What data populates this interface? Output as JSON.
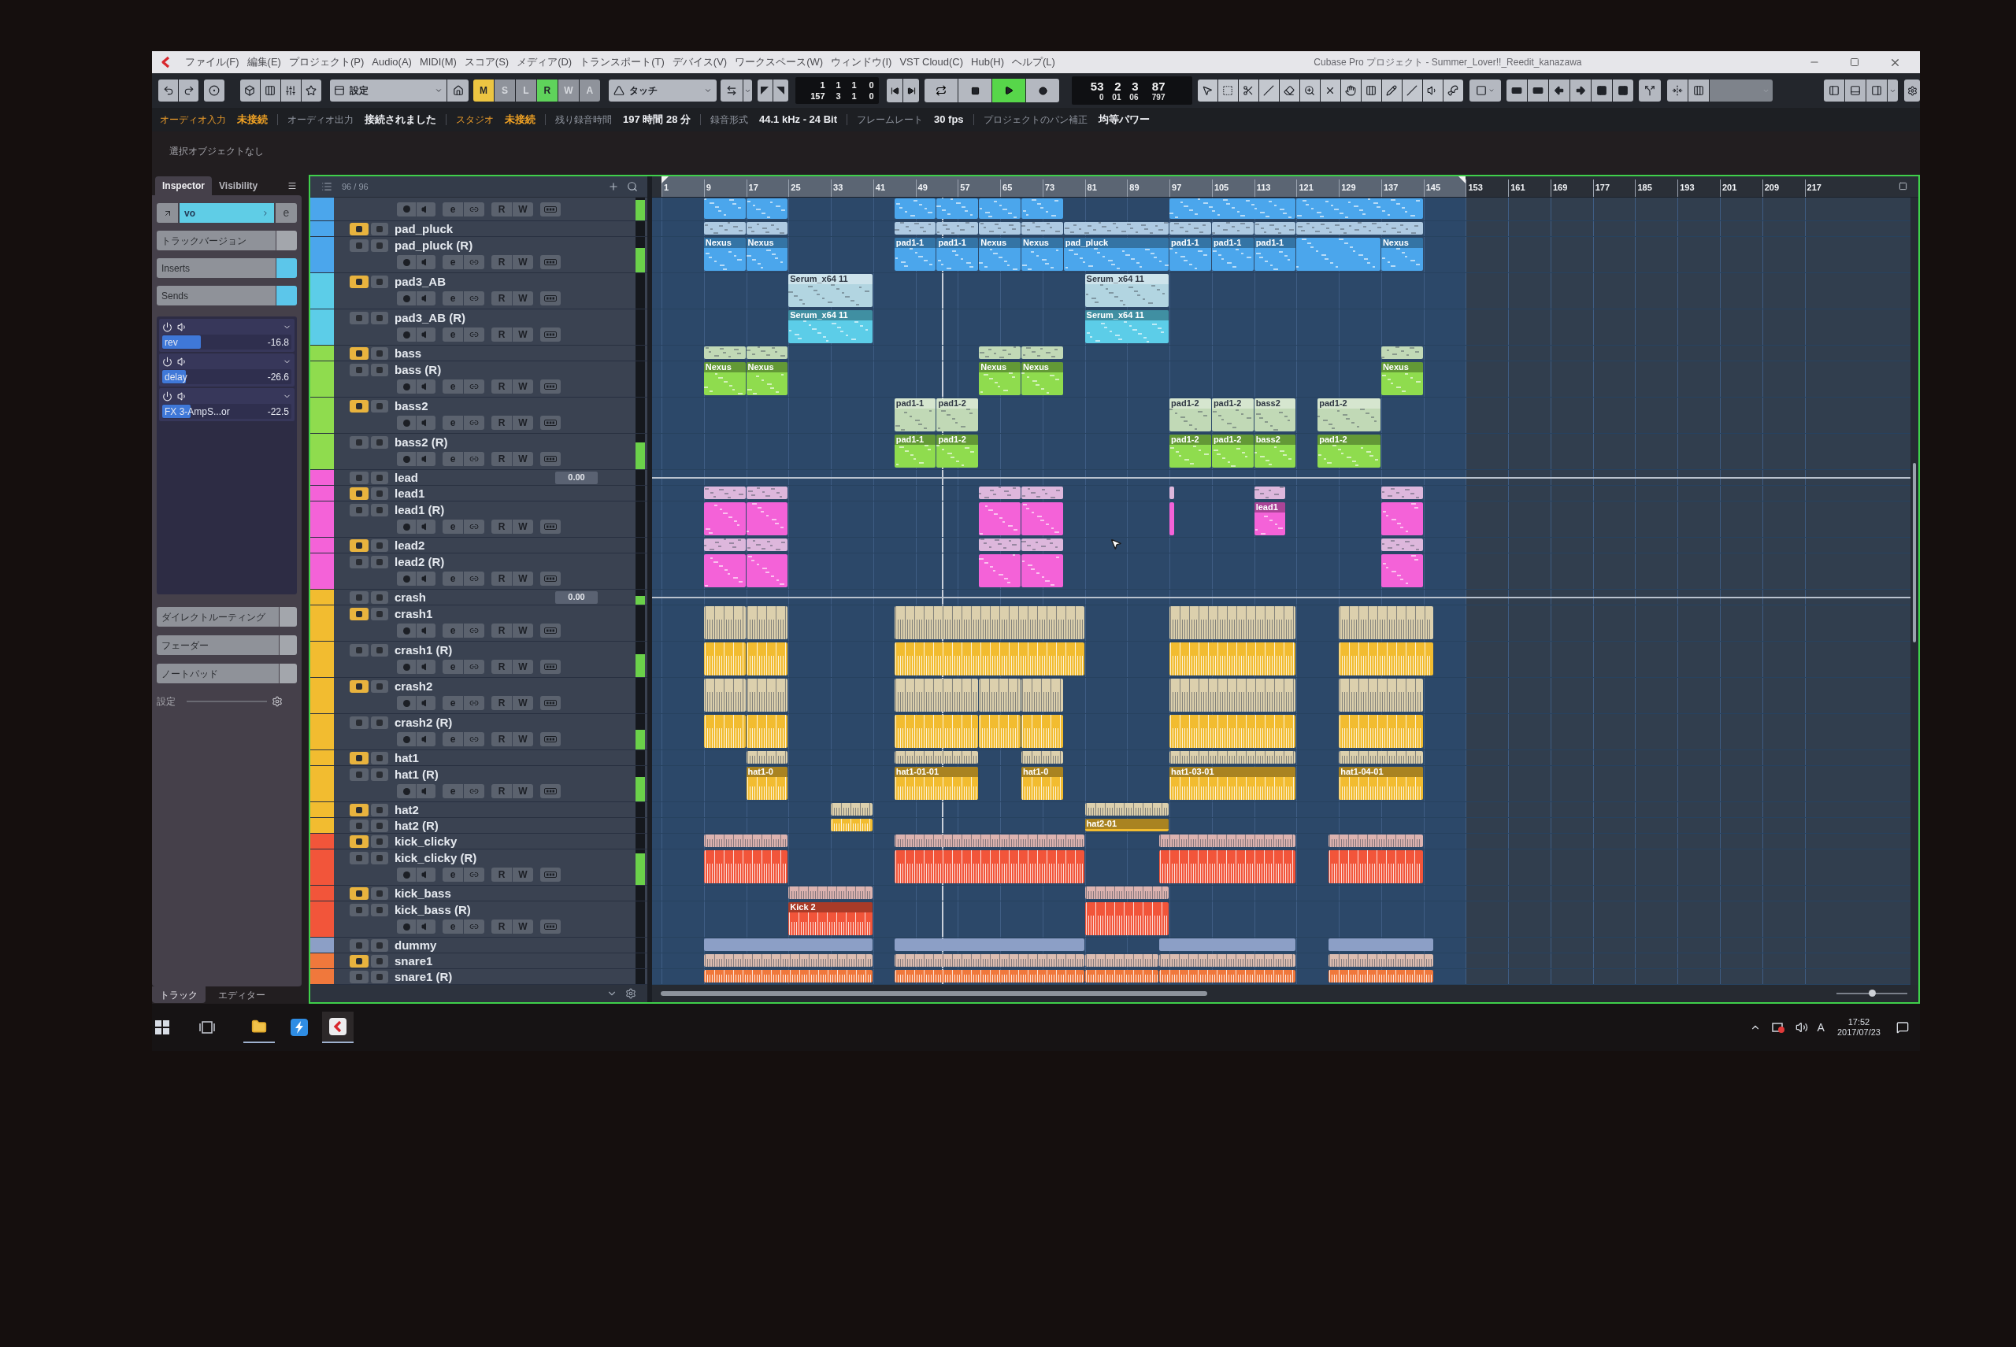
{
  "window": {
    "title": "Cubase Pro プロジェクト - Summer_Lover!!_Reedit_kanazawa"
  },
  "menu": [
    "ファイル(F)",
    "編集(E)",
    "プロジェクト(P)",
    "Audio(A)",
    "MIDI(M)",
    "スコア(S)",
    "メディア(D)",
    "トランスポート(T)",
    "デバイス(V)",
    "ワークスペース(W)",
    "ウィンドウ(I)",
    "VST Cloud(C)",
    "Hub(H)",
    "ヘルプ(L)"
  ],
  "toolbar": {
    "preset": "設定",
    "automation_buttons": [
      {
        "label": "M",
        "kind": "mute",
        "on": true
      },
      {
        "label": "S",
        "kind": "solo",
        "on": false
      },
      {
        "label": "L",
        "kind": "listen",
        "on": false
      },
      {
        "label": "R",
        "kind": "read",
        "on": true
      },
      {
        "label": "W",
        "kind": "write",
        "on": false
      },
      {
        "label": "A",
        "kind": "all",
        "on": false
      }
    ],
    "automation_mode": "タッチ",
    "locators": [
      [
        "1",
        "1",
        "1",
        "0"
      ],
      [
        "157",
        "3",
        "1",
        "0"
      ]
    ],
    "transport": [
      {
        "kind": "previous",
        "on": false
      },
      {
        "kind": "next",
        "on": false
      },
      {
        "kind": "cycle",
        "on": false
      },
      {
        "kind": "stop",
        "on": false
      },
      {
        "kind": "play",
        "on": true
      },
      {
        "kind": "record",
        "on": false
      }
    ],
    "position": {
      "bars": [
        "53",
        "2",
        "3",
        "87"
      ],
      "time": [
        "0",
        "01",
        "06",
        "797"
      ]
    }
  },
  "status_bar": [
    {
      "label": "オーディオ入力",
      "value": "未接続",
      "warning": true
    },
    {
      "label": "オーディオ出力",
      "value": "接続されました",
      "warning": false
    },
    {
      "label": "スタジオ",
      "value": "未接続",
      "warning": true
    },
    {
      "label": "残り録音時間",
      "value": "197 時間 28 分",
      "warning": false
    },
    {
      "label": "録音形式",
      "value": "44.1 kHz - 24 Bit",
      "warning": false
    },
    {
      "label": "フレームレート",
      "value": "30 fps",
      "warning": false
    },
    {
      "label": "プロジェクトのパン補正",
      "value": "均等パワー",
      "warning": false
    }
  ],
  "selection_info": "選択オブジェクトなし",
  "inspector": {
    "tabs": [
      {
        "label": "Inspector",
        "selected": true
      },
      {
        "label": "Visibility",
        "selected": false
      }
    ],
    "track_name": "vo",
    "edit_label": "e",
    "sections": [
      {
        "label": "トラックバージョン",
        "active": false
      },
      {
        "label": "Inserts",
        "active": true
      },
      {
        "label": "Sends",
        "active": true
      }
    ],
    "sends": [
      {
        "name": "rev",
        "value": "-16.8",
        "level": 0.3
      },
      {
        "name": "delay",
        "value": "-26.6",
        "level": 0.18
      },
      {
        "name": "FX 3-AmpS...or",
        "value": "-22.5",
        "level": 0.22
      }
    ],
    "panels": [
      "ダイレクトルーティング",
      "フェーダー",
      "ノートパッド"
    ],
    "settings_label": "設定",
    "bottom_tabs": [
      {
        "label": "トラック",
        "selected": true
      },
      {
        "label": "エディター",
        "selected": false
      }
    ]
  },
  "track_list": {
    "count": "96 / 96"
  },
  "tracks": [
    {
      "kind": "controls",
      "color": "#4ba6ec",
      "level": 0.9,
      "controls": [
        "e",
        "R",
        "W"
      ]
    },
    {
      "kind": "compact",
      "name": "pad_pluck",
      "color": "#4ba6ec",
      "muted": true
    },
    {
      "kind": "expanded",
      "name": "pad_pluck (R)",
      "color": "#4ba6ec",
      "muted": false,
      "level": 0.7,
      "controls": [
        "e",
        "R",
        "W"
      ],
      "clips": [
        "Nexus",
        "Nexus",
        "pad1-1",
        "pad1-1",
        "Nexus",
        "Nexus",
        "pad_pluck",
        "pad1-1",
        "pad1-1",
        "pad1-1",
        "Nexus"
      ]
    },
    {
      "kind": "expanded",
      "name": "pad3_AB",
      "color": "#5ccde8",
      "muted": true,
      "controls": [
        "e",
        "R",
        "W"
      ],
      "clips": [
        "Serum_x64 11",
        "Serum_x64 11"
      ]
    },
    {
      "kind": "expanded",
      "name": "pad3_AB (R)",
      "color": "#5ccde8",
      "muted": false,
      "controls": [
        "e",
        "R",
        "W"
      ],
      "clips": [
        "Serum_x64 11",
        "Serum_x64 11"
      ]
    },
    {
      "kind": "compact",
      "name": "bass",
      "color": "#8fdc4e",
      "muted": true
    },
    {
      "kind": "expanded",
      "name": "bass (R)",
      "color": "#8fdc4e",
      "muted": false,
      "controls": [
        "e",
        "R",
        "W"
      ],
      "clips": [
        "Nexus",
        "Nexus",
        "Nexus",
        "Nexus",
        "Nexus"
      ]
    },
    {
      "kind": "expanded",
      "name": "bass2",
      "color": "#8fdc4e",
      "muted": true,
      "controls": [
        "e",
        "R",
        "W"
      ],
      "clips": [
        "pad1-1",
        "pad1-2",
        "pad1-2",
        "pad1-2",
        "bass2",
        "pad1-2"
      ]
    },
    {
      "kind": "expanded",
      "name": "bass2 (R)",
      "color": "#8fdc4e",
      "muted": false,
      "level": 0.75,
      "controls": [
        "e",
        "R",
        "W"
      ],
      "clips": [
        "pad1-1",
        "pad1-2",
        "pad1-2",
        "pad1-2",
        "bass2",
        "pad1-2"
      ]
    },
    {
      "kind": "folder",
      "name": "lead",
      "color": "#f462d8",
      "muted": false,
      "volume": "0.00"
    },
    {
      "kind": "compact",
      "name": "lead1",
      "color": "#f462d8",
      "muted": true
    },
    {
      "kind": "expanded",
      "name": "lead1 (R)",
      "color": "#f462d8",
      "muted": false,
      "controls": [
        "e",
        "R",
        "W"
      ],
      "clips": [
        "lead1"
      ]
    },
    {
      "kind": "compact",
      "name": "lead2",
      "color": "#f462d8",
      "muted": true
    },
    {
      "kind": "expanded",
      "name": "lead2 (R)",
      "color": "#f462d8",
      "muted": false,
      "controls": [
        "e",
        "R",
        "W"
      ]
    },
    {
      "kind": "folder",
      "name": "crash",
      "color": "#f2bc30",
      "muted": false,
      "volume": "0.00",
      "level": 0.6
    },
    {
      "kind": "expanded",
      "name": "crash1",
      "color": "#f2bc30",
      "muted": true,
      "controls": [
        "e",
        "R",
        "W"
      ]
    },
    {
      "kind": "expanded",
      "name": "crash1 (R)",
      "color": "#f2bc30",
      "muted": false,
      "level": 0.65,
      "controls": [
        "e",
        "R",
        "W"
      ]
    },
    {
      "kind": "expanded",
      "name": "crash2",
      "color": "#f2bc30",
      "muted": true,
      "controls": [
        "e",
        "R",
        "W"
      ]
    },
    {
      "kind": "expanded",
      "name": "crash2 (R)",
      "color": "#f2bc30",
      "muted": false,
      "level": 0.55,
      "controls": [
        "e",
        "R",
        "W"
      ]
    },
    {
      "kind": "compact",
      "name": "hat1",
      "color": "#f2bc30",
      "muted": true
    },
    {
      "kind": "expanded",
      "name": "hat1 (R)",
      "color": "#f2bc30",
      "muted": false,
      "level": 0.7,
      "controls": [
        "e",
        "R",
        "W"
      ],
      "clips": [
        "hat1-0",
        "hat1-01-01",
        "hat1-0",
        "hat1-03-01",
        "hat1-04-01"
      ]
    },
    {
      "kind": "compact",
      "name": "hat2",
      "color": "#f2bc30",
      "muted": true
    },
    {
      "kind": "compact",
      "name": "hat2 (R)",
      "color": "#f2bc30",
      "muted": false,
      "clips": [
        "hat2-01"
      ]
    },
    {
      "kind": "compact",
      "name": "kick_clicky",
      "color": "#f2553a",
      "muted": true
    },
    {
      "kind": "expanded",
      "name": "kick_clicky (R)",
      "color": "#f2553a",
      "muted": false,
      "level": 0.9,
      "controls": [
        "e",
        "R",
        "W"
      ]
    },
    {
      "kind": "compact",
      "name": "kick_bass",
      "color": "#f2553a",
      "muted": true
    },
    {
      "kind": "expanded",
      "name": "kick_bass (R)",
      "color": "#f2553a",
      "muted": false,
      "controls": [
        "e",
        "R",
        "W"
      ],
      "clips": [
        "Kick 2"
      ]
    },
    {
      "kind": "compact",
      "name": "dummy",
      "color": "#8c9fc6",
      "muted": false
    },
    {
      "kind": "compact",
      "name": "snare1",
      "color": "#f0783c",
      "muted": true
    },
    {
      "kind": "compact",
      "name": "snare1 (R)",
      "color": "#f0783c",
      "muted": false
    }
  ],
  "ruler": [
    "1",
    "9",
    "17",
    "25",
    "33",
    "41",
    "49",
    "57",
    "65",
    "73",
    "81",
    "89",
    "97",
    "105",
    "113",
    "121",
    "129",
    "137",
    "145",
    "153",
    "161",
    "169",
    "177",
    "185",
    "193",
    "201",
    "209",
    "217"
  ],
  "horizontal_zoom": {
    "level": 0.5
  },
  "taskbar": {
    "ime": "A",
    "time": "17:52",
    "date": "2017/07/23"
  }
}
